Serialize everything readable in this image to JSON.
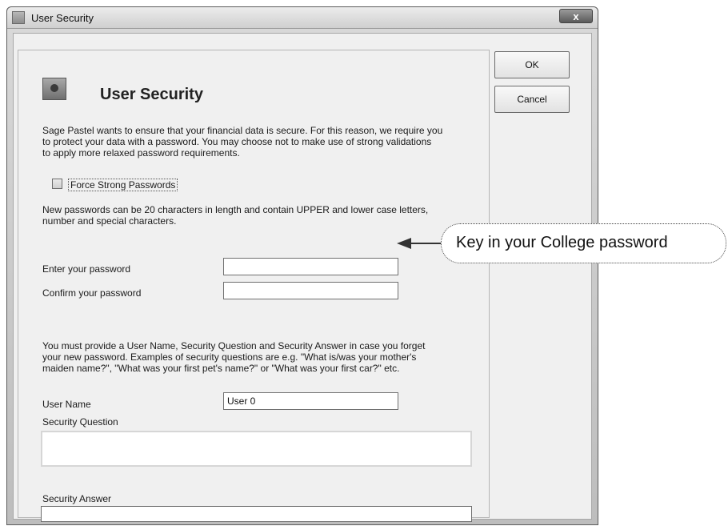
{
  "window": {
    "title": "User Security",
    "close_symbol": "x"
  },
  "header": {
    "title": "User Security"
  },
  "intro_lines": [
    "Sage Pastel wants to ensure that your financial data is secure. For this reason, we require you",
    "to protect your data with a password. You may choose not to make use of strong validations",
    "to apply more relaxed password requirements."
  ],
  "force_strong": {
    "label": "Force Strong Passwords",
    "checked": false
  },
  "rule_lines": [
    "New passwords can be 20 characters in length and contain UPPER and lower case letters,",
    "number and special characters."
  ],
  "password": {
    "label": "Enter your password",
    "value": ""
  },
  "confirm": {
    "label": "Confirm your password",
    "value": ""
  },
  "info_lines": [
    "You must provide a User Name, Security Question and Security Answer in case you forget",
    "your new password. Examples of security questions are e.g. \"What is/was your mother's",
    "maiden name?\", \"What was your first pet's name?\" or \"What was your first car?\" etc."
  ],
  "user_name": {
    "label": "User Name",
    "value": "User 0"
  },
  "security_question": {
    "label": "Security Question",
    "value": ""
  },
  "security_answer": {
    "label": "Security Answer",
    "value": ""
  },
  "buttons": {
    "ok": "OK",
    "cancel": "Cancel"
  },
  "callout": {
    "text": "Key in your College password"
  }
}
